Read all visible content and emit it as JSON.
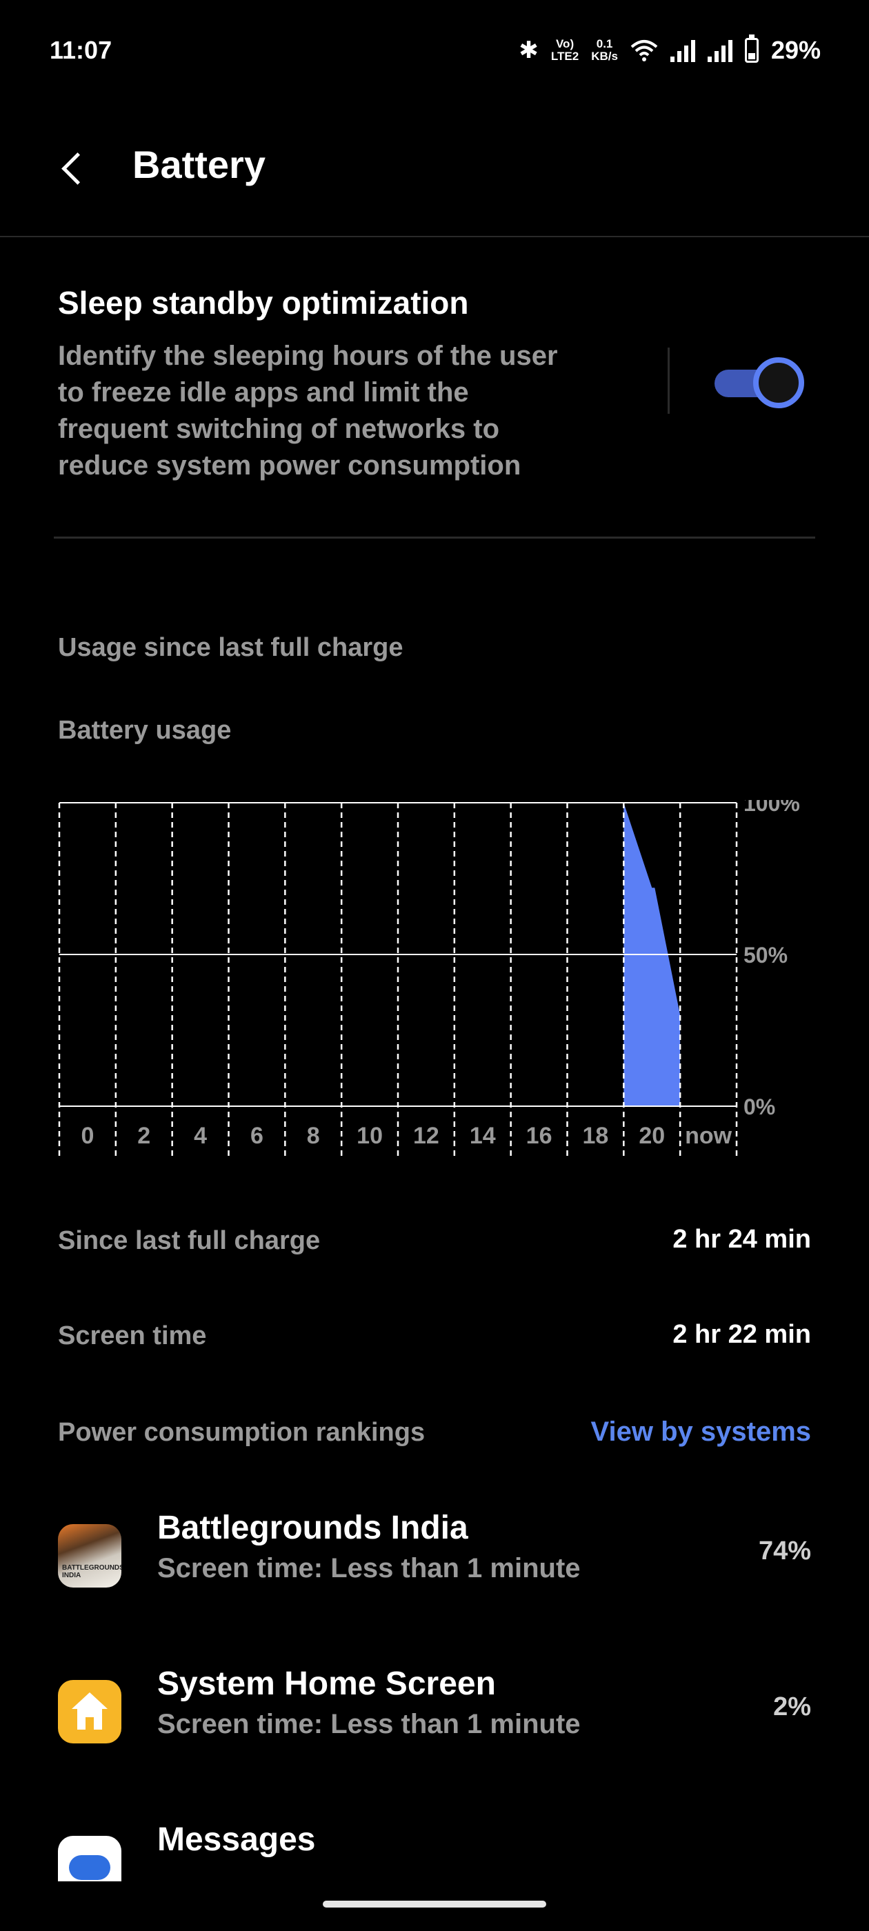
{
  "status_bar": {
    "time": "11:07",
    "volte": "Vo) LTE2",
    "volte_top": "Vo)",
    "volte_bottom": "LTE2",
    "speed_top": "0.1",
    "speed_bottom": "KB/s",
    "battery_text": "29%",
    "icons": [
      "bluetooth-icon",
      "wifi-icon",
      "signal-icon",
      "signal-icon",
      "battery-icon"
    ]
  },
  "header": {
    "title": "Battery",
    "back_icon": "back-arrow-icon"
  },
  "sleep_standby": {
    "title": "Sleep standby optimization",
    "description": "Identify the sleeping hours of the user to freeze idle apps and limit the frequent switching of networks to reduce system power consumption",
    "enabled": true,
    "accent_color": "#5b7ff5"
  },
  "usage_section": {
    "label": "Usage since last full charge"
  },
  "chart_title": "Battery usage",
  "chart_data": {
    "type": "area",
    "x_tick_labels": [
      "0",
      "2",
      "4",
      "6",
      "8",
      "10",
      "12",
      "14",
      "16",
      "18",
      "20",
      "now"
    ],
    "y_tick_labels": [
      "100%",
      "50%",
      "0%"
    ],
    "ylim": [
      0,
      100
    ],
    "series": [
      {
        "x": [
          20,
          21,
          21.1,
          22
        ],
        "y": [
          100,
          72,
          72,
          30
        ]
      }
    ],
    "grid": true,
    "color": "#5b7ff5"
  },
  "stats": {
    "since_label": "Since last full charge",
    "since_value": "2 hr 24 min",
    "screen_label": "Screen time",
    "screen_value": "2 hr 22 min"
  },
  "rankings": {
    "label": "Power consumption rankings",
    "link": "View by systems",
    "link_color": "#5b86ef"
  },
  "apps": [
    {
      "name": "Battlegrounds India",
      "sub": "Screen time: Less than 1 minute",
      "percent": "74%",
      "icon": "battlegrounds-app-icon",
      "icon_text": "BATTLEGROUNDS INDIA"
    },
    {
      "name": "System Home Screen",
      "sub": "Screen time: Less than 1 minute",
      "percent": "2%",
      "icon": "home-screen-app-icon"
    },
    {
      "name": "Messages",
      "icon": "messages-app-icon"
    }
  ]
}
